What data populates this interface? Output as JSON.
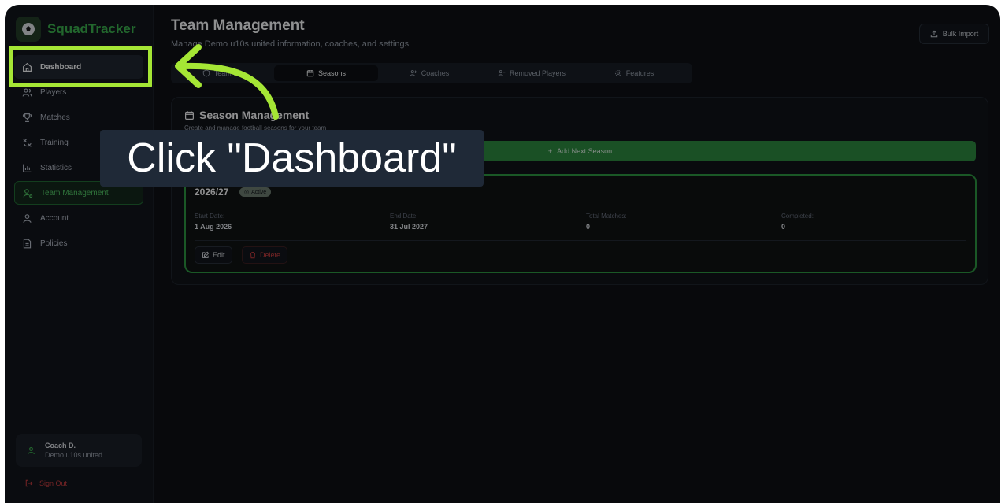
{
  "brand": {
    "name": "SquadTracker",
    "logo_icon": "soccer-ball-icon"
  },
  "sidebar": {
    "items": [
      {
        "label": "Dashboard",
        "icon": "home-icon"
      },
      {
        "label": "Players",
        "icon": "users-icon"
      },
      {
        "label": "Matches",
        "icon": "trophy-icon"
      },
      {
        "label": "Training",
        "icon": "training-icon"
      },
      {
        "label": "Statistics",
        "icon": "bar-chart-icon"
      },
      {
        "label": "Team Management",
        "icon": "user-cog-icon"
      },
      {
        "label": "Account",
        "icon": "user-icon"
      },
      {
        "label": "Policies",
        "icon": "file-icon"
      }
    ],
    "user": {
      "name": "Coach D.",
      "team": "Demo u10s united"
    },
    "sign_out": "Sign Out"
  },
  "header": {
    "title": "Team Management",
    "subtitle": "Manage Demo u10s united information, coaches, and settings",
    "bulk_import": "Bulk Import"
  },
  "tabs": [
    {
      "label": "Team Info",
      "icon": "shield-icon"
    },
    {
      "label": "Seasons",
      "icon": "calendar-icon",
      "selected": true
    },
    {
      "label": "Coaches",
      "icon": "users-icon"
    },
    {
      "label": "Removed Players",
      "icon": "user-minus-icon"
    },
    {
      "label": "Features",
      "icon": "gear-icon"
    }
  ],
  "panel": {
    "title": "Season Management",
    "subtitle": "Create and manage football seasons for your team",
    "add_button": "Add Next Season"
  },
  "season": {
    "name": "2026/27",
    "status": "Active",
    "start_label": "Start Date:",
    "start_value": "1 Aug 2026",
    "end_label": "End Date:",
    "end_value": "31 Jul 2027",
    "matches_label": "Total Matches:",
    "matches_value": "0",
    "completed_label": "Completed:",
    "completed_value": "0",
    "edit": "Edit",
    "delete": "Delete"
  },
  "tutorial": {
    "callout": "Click \"Dashboard\"",
    "highlight_color": "#a5e635"
  },
  "colors": {
    "accent": "#39b54a",
    "danger": "#d23b3b",
    "background": "#08090c"
  }
}
